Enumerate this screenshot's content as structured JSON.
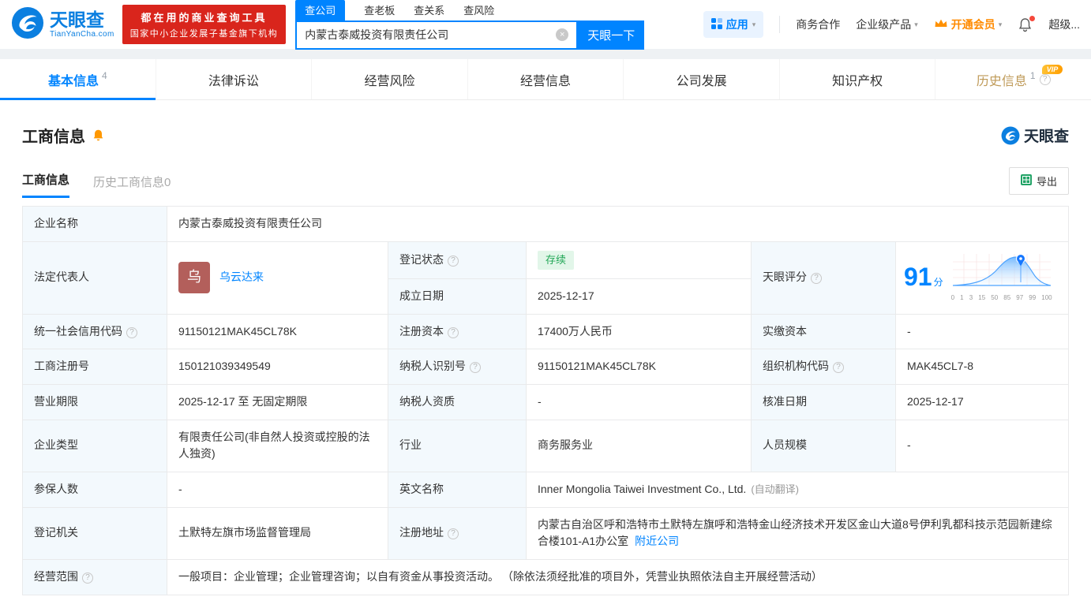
{
  "brand": {
    "name": "天眼查",
    "domain": "TianYanCha.com"
  },
  "header": {
    "promo_line1": "都在用的商业查询工具",
    "promo_line2": "国家中小企业发展子基金旗下机构",
    "search_tabs": [
      {
        "label": "查公司"
      },
      {
        "label": "查老板"
      },
      {
        "label": "查关系"
      },
      {
        "label": "查风险"
      }
    ],
    "search_value": "内蒙古泰威投资有限责任公司",
    "search_button": "天眼一下",
    "nav_apps": "应用",
    "nav_cooperation": "商务合作",
    "nav_enterprise": "企业级产品",
    "nav_vip": "开通会员",
    "nav_super": "超级..."
  },
  "tabs": [
    {
      "label": "基本信息",
      "count": "4"
    },
    {
      "label": "法律诉讼"
    },
    {
      "label": "经营风险"
    },
    {
      "label": "经营信息"
    },
    {
      "label": "公司发展"
    },
    {
      "label": "知识产权"
    },
    {
      "label": "历史信息",
      "count": "1",
      "vip_tag": "VIP"
    }
  ],
  "section": {
    "title": "工商信息",
    "watermark": "天眼查",
    "subtab_current": "工商信息",
    "subtab_history": "历史工商信息0",
    "export_label": "导出"
  },
  "icons": {
    "help": "?",
    "clear": "×",
    "caret": "▾"
  },
  "info": {
    "company_name": {
      "label": "企业名称",
      "value": "内蒙古泰威投资有限责任公司"
    },
    "legal_rep": {
      "label": "法定代表人",
      "avatar": "乌",
      "value": "乌云达来"
    },
    "reg_status": {
      "label": "登记状态",
      "value": "存续"
    },
    "establish_date": {
      "label": "成立日期",
      "value": "2025-12-17"
    },
    "score": {
      "label": "天眼评分"
    },
    "credit_code": {
      "label": "统一社会信用代码",
      "value": "91150121MAK45CL78K"
    },
    "reg_capital": {
      "label": "注册资本",
      "value": "17400万人民币"
    },
    "paid_capital": {
      "label": "实缴资本",
      "value": "-"
    },
    "reg_number": {
      "label": "工商注册号",
      "value": "150121039349549"
    },
    "taxpayer_id": {
      "label": "纳税人识别号",
      "value": "91150121MAK45CL78K"
    },
    "org_code": {
      "label": "组织机构代码",
      "value": "MAK45CL7-8"
    },
    "business_term": {
      "label": "营业期限",
      "value": "2025-12-17 至 无固定期限"
    },
    "taxpayer_quality": {
      "label": "纳税人资质",
      "value": "-"
    },
    "approval_date": {
      "label": "核准日期",
      "value": "2025-12-17"
    },
    "company_type": {
      "label": "企业类型",
      "value": "有限责任公司(非自然人投资或控股的法人独资)"
    },
    "industry": {
      "label": "行业",
      "value": "商务服务业"
    },
    "staff_size": {
      "label": "人员规模",
      "value": "-"
    },
    "insured_count": {
      "label": "参保人数",
      "value": "-"
    },
    "english_name": {
      "label": "英文名称",
      "value": "Inner Mongolia Taiwei Investment Co., Ltd.",
      "note": "(自动翻译)"
    },
    "reg_authority": {
      "label": "登记机关",
      "value": "土默特左旗市场监督管理局"
    },
    "reg_address": {
      "label": "注册地址",
      "value": "内蒙古自治区呼和浩特市土默特左旗呼和浩特金山经济技术开发区金山大道8号伊利乳都科技示范园新建综合楼101-A1办公室",
      "nearby_link": "附近公司"
    },
    "business_scope": {
      "label": "经营范围",
      "value": "一般项目：企业管理；企业管理咨询；以自有资金从事投资活动。 （除依法须经批准的项目外，凭营业执照依法自主开展经营活动）"
    }
  },
  "score_chart": {
    "score": "91",
    "unit": "分",
    "axis": [
      "0",
      "1",
      "3",
      "15",
      "50",
      "85",
      "97",
      "99",
      "100"
    ]
  }
}
